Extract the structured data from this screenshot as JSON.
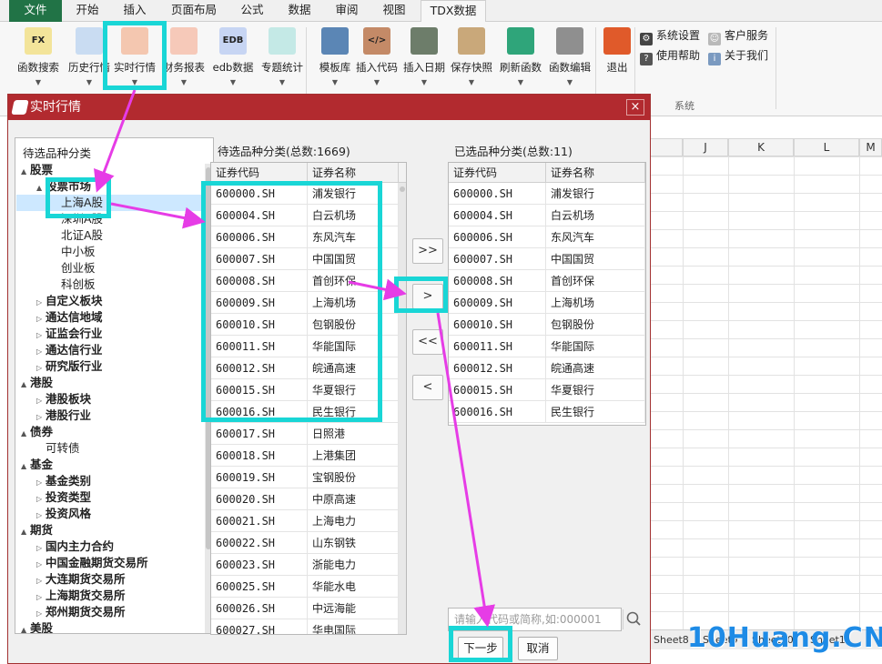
{
  "ribbon": {
    "tabs": [
      "文件",
      "开始",
      "插入",
      "页面布局",
      "公式",
      "数据",
      "审阅",
      "视图",
      "TDX数据"
    ],
    "buttons": [
      {
        "label": "函数搜索",
        "icon": "fx-icon",
        "badge": "FX",
        "color": "#f3e49a"
      },
      {
        "label": "历史行情",
        "icon": "history-chart-icon",
        "badge": "",
        "color": "#c9dcf2"
      },
      {
        "label": "实时行情",
        "icon": "realtime-chart-icon",
        "badge": "",
        "color": "#f4c7b0"
      },
      {
        "label": "财务报表",
        "icon": "pie-icon",
        "badge": "",
        "color": "#f6c9b9"
      },
      {
        "label": "edb数据",
        "icon": "edb-icon",
        "badge": "EDB",
        "color": "#c7d5f3"
      },
      {
        "label": "专题统计",
        "icon": "stats-icon",
        "badge": "",
        "color": "#c4e9e6"
      },
      {
        "label": "模板库",
        "icon": "template-icon",
        "badge": "",
        "color": "#5b86b5"
      },
      {
        "label": "插入代码",
        "icon": "code-icon",
        "badge": "</>",
        "color": "#c48a67"
      },
      {
        "label": "插入日期",
        "icon": "calendar-icon",
        "badge": "",
        "color": "#6d7d6a"
      },
      {
        "label": "保存快照",
        "icon": "save-snapshot-icon",
        "badge": "",
        "color": "#c9a87a"
      },
      {
        "label": "刷新函数",
        "icon": "refresh-icon",
        "badge": "",
        "color": "#2fa57a"
      },
      {
        "label": "函数编辑",
        "icon": "edit-icon",
        "badge": "",
        "color": "#8f8f8f"
      },
      {
        "label": "退出",
        "icon": "exit-icon",
        "badge": "",
        "color": "#e05a2a"
      }
    ],
    "system": {
      "settings": "系统设置",
      "service": "客户服务",
      "help": "使用帮助",
      "about": "关于我们",
      "group_label": "系统"
    }
  },
  "dialog": {
    "title": "实时行情",
    "close": "×",
    "tree": {
      "title": "待选品种分类",
      "items": [
        {
          "label": "股票",
          "level": 0,
          "bold": true,
          "arrow": "▲"
        },
        {
          "label": "股票市场",
          "level": 1,
          "bold": true,
          "arrow": "▲"
        },
        {
          "label": "上海A股",
          "level": 2,
          "bold": false,
          "arrow": "",
          "selected": true
        },
        {
          "label": "深圳A股",
          "level": 2,
          "bold": false,
          "arrow": ""
        },
        {
          "label": "北证A股",
          "level": 2,
          "bold": false,
          "arrow": ""
        },
        {
          "label": "中小板",
          "level": 2,
          "bold": false,
          "arrow": ""
        },
        {
          "label": "创业板",
          "level": 2,
          "bold": false,
          "arrow": ""
        },
        {
          "label": "科创板",
          "level": 2,
          "bold": false,
          "arrow": ""
        },
        {
          "label": "自定义板块",
          "level": 1,
          "bold": true,
          "arrow": "▷"
        },
        {
          "label": "通达信地域",
          "level": 1,
          "bold": true,
          "arrow": "▷"
        },
        {
          "label": "证监会行业",
          "level": 1,
          "bold": true,
          "arrow": "▷"
        },
        {
          "label": "通达信行业",
          "level": 1,
          "bold": true,
          "arrow": "▷"
        },
        {
          "label": "研究版行业",
          "level": 1,
          "bold": true,
          "arrow": "▷"
        },
        {
          "label": "港股",
          "level": 0,
          "bold": true,
          "arrow": "▲"
        },
        {
          "label": "港股板块",
          "level": 1,
          "bold": true,
          "arrow": "▷"
        },
        {
          "label": "港股行业",
          "level": 1,
          "bold": true,
          "arrow": "▷"
        },
        {
          "label": "债券",
          "level": 0,
          "bold": true,
          "arrow": "▲"
        },
        {
          "label": "可转债",
          "level": 1,
          "bold": false,
          "arrow": ""
        },
        {
          "label": "基金",
          "level": 0,
          "bold": true,
          "arrow": "▲"
        },
        {
          "label": "基金类别",
          "level": 1,
          "bold": true,
          "arrow": "▷"
        },
        {
          "label": "投资类型",
          "level": 1,
          "bold": true,
          "arrow": "▷"
        },
        {
          "label": "投资风格",
          "level": 1,
          "bold": true,
          "arrow": "▷"
        },
        {
          "label": "期货",
          "level": 0,
          "bold": true,
          "arrow": "▲"
        },
        {
          "label": "国内主力合约",
          "level": 1,
          "bold": true,
          "arrow": "▷"
        },
        {
          "label": "中国金融期货交易所",
          "level": 1,
          "bold": true,
          "arrow": "▷"
        },
        {
          "label": "大连期货交易所",
          "level": 1,
          "bold": true,
          "arrow": "▷"
        },
        {
          "label": "上海期货交易所",
          "level": 1,
          "bold": true,
          "arrow": "▷"
        },
        {
          "label": "郑州期货交易所",
          "level": 1,
          "bold": true,
          "arrow": "▷"
        },
        {
          "label": "美股",
          "level": 0,
          "bold": true,
          "arrow": "▲"
        }
      ]
    },
    "candidates": {
      "title": "待选品种分类(总数:1669)",
      "col_code": "证券代码",
      "col_name": "证券名称",
      "rows": [
        {
          "code": "600000.SH",
          "name": "浦发银行"
        },
        {
          "code": "600004.SH",
          "name": "白云机场"
        },
        {
          "code": "600006.SH",
          "name": "东风汽车"
        },
        {
          "code": "600007.SH",
          "name": "中国国贸"
        },
        {
          "code": "600008.SH",
          "name": "首创环保"
        },
        {
          "code": "600009.SH",
          "name": "上海机场"
        },
        {
          "code": "600010.SH",
          "name": "包钢股份"
        },
        {
          "code": "600011.SH",
          "name": "华能国际"
        },
        {
          "code": "600012.SH",
          "name": "皖通高速"
        },
        {
          "code": "600015.SH",
          "name": "华夏银行"
        },
        {
          "code": "600016.SH",
          "name": "民生银行"
        },
        {
          "code": "600017.SH",
          "name": "日照港"
        },
        {
          "code": "600018.SH",
          "name": "上港集团"
        },
        {
          "code": "600019.SH",
          "name": "宝钢股份"
        },
        {
          "code": "600020.SH",
          "name": "中原高速"
        },
        {
          "code": "600021.SH",
          "name": "上海电力"
        },
        {
          "code": "600022.SH",
          "name": "山东钢铁"
        },
        {
          "code": "600023.SH",
          "name": "浙能电力"
        },
        {
          "code": "600025.SH",
          "name": "华能水电"
        },
        {
          "code": "600026.SH",
          "name": "中远海能"
        },
        {
          "code": "600027.SH",
          "name": "华电国际"
        }
      ]
    },
    "selected": {
      "title": "已选品种分类(总数:11)",
      "col_code": "证券代码",
      "col_name": "证券名称",
      "rows": [
        {
          "code": "600000.SH",
          "name": "浦发银行"
        },
        {
          "code": "600004.SH",
          "name": "白云机场"
        },
        {
          "code": "600006.SH",
          "name": "东风汽车"
        },
        {
          "code": "600007.SH",
          "name": "中国国贸"
        },
        {
          "code": "600008.SH",
          "name": "首创环保"
        },
        {
          "code": "600009.SH",
          "name": "上海机场"
        },
        {
          "code": "600010.SH",
          "name": "包钢股份"
        },
        {
          "code": "600011.SH",
          "name": "华能国际"
        },
        {
          "code": "600012.SH",
          "name": "皖通高速"
        },
        {
          "code": "600015.SH",
          "name": "华夏银行"
        },
        {
          "code": "600016.SH",
          "name": "民生银行"
        }
      ]
    },
    "move_buttons": {
      "add_all": ">>",
      "add": ">",
      "remove_all": "<<",
      "remove": "<"
    },
    "search_placeholder": "请输入代码或简称,如:000001",
    "next_button": "下一步",
    "cancel_button": "取消"
  },
  "sheet": {
    "columns": [
      "J",
      "K",
      "L",
      "M"
    ],
    "tabs": [
      "Sheet8",
      "Sheet9",
      "Sheet10",
      "Sheet11"
    ]
  },
  "watermark": "10Huang.CN",
  "colors": {
    "dialog_title_bar": "#b22a2f",
    "highlight_box": "#19d6d6",
    "annotation_arrow": "#e63ce6",
    "excel_green": "#217346",
    "selection": "#cde8ff"
  }
}
